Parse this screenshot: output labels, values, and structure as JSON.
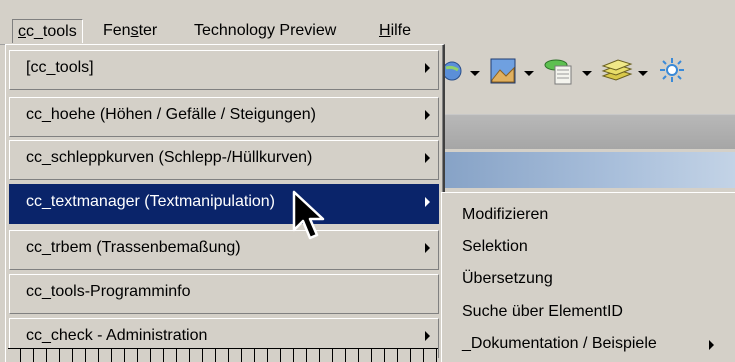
{
  "menubar": {
    "items": [
      {
        "label": "cc_tools",
        "underline": "c",
        "rest": "c_tools"
      },
      {
        "label": "Fenster",
        "pre": "Fen",
        "underline": "s",
        "rest": "ter"
      },
      {
        "label": "Technology Preview"
      },
      {
        "label": "Hilfe",
        "underline": "H",
        "rest": "ilfe"
      }
    ]
  },
  "menu": {
    "items": [
      {
        "label": "[cc_tools]",
        "has_submenu": true
      },
      {
        "label": "cc_hoehe  (Höhen / Gefälle / Steigungen)",
        "has_submenu": true
      },
      {
        "label": "cc_schleppkurven  (Schlepp-/Hüllkurven)",
        "has_submenu": true
      },
      {
        "label": "cc_textmanager  (Textmanipulation)",
        "has_submenu": true,
        "selected": true
      },
      {
        "label": "cc_trbem  (Trassenbemaßung)",
        "has_submenu": true
      },
      {
        "label": "cc_tools-Programminfo",
        "has_submenu": false
      },
      {
        "label": "cc_check - Administration",
        "has_submenu": true
      }
    ]
  },
  "submenu": {
    "items": [
      {
        "label": "Modifizieren"
      },
      {
        "label": "Selektion"
      },
      {
        "label": "Übersetzung"
      },
      {
        "label": "Suche über ElementID"
      },
      {
        "label": "_Dokumentation / Beispiele",
        "has_submenu": true
      }
    ]
  },
  "colors": {
    "selection": "#0a246a",
    "menu_bg": "#d4d0c8"
  }
}
